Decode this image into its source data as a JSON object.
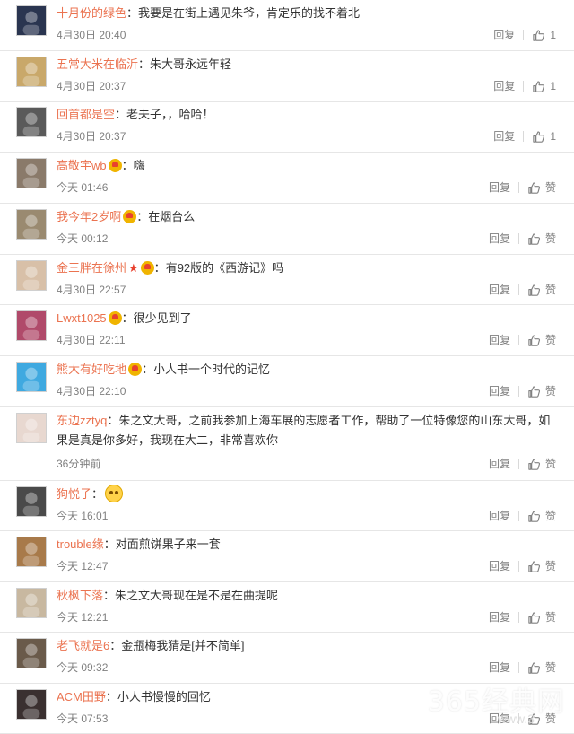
{
  "comments": [
    {
      "user": "十月份的绿色",
      "badge": false,
      "star": false,
      "text": "我要是在街上遇见朱爷，肯定乐的找不着北",
      "time": "4月30日 20:40",
      "reply": "回复",
      "like": "1",
      "avatar_color": "#2a3550"
    },
    {
      "user": "五常大米在临沂",
      "badge": false,
      "star": false,
      "text": "朱大哥永远年轻",
      "time": "4月30日 20:37",
      "reply": "回复",
      "like": "1",
      "avatar_color": "#c9a86a"
    },
    {
      "user": "回首都是空",
      "badge": false,
      "star": false,
      "text": "老夫子，，哈哈！",
      "time": "4月30日 20:37",
      "reply": "回复",
      "like": "1",
      "avatar_color": "#5a5a5a"
    },
    {
      "user": "高敬宇wb",
      "badge": true,
      "star": false,
      "text": "嗨",
      "time": "今天 01:46",
      "reply": "回复",
      "like": "赞",
      "avatar_color": "#8a7a6a"
    },
    {
      "user": "我今年2岁啊",
      "badge": true,
      "star": false,
      "text": "在烟台么",
      "time": "今天 00:12",
      "reply": "回复",
      "like": "赞",
      "avatar_color": "#9a8a70"
    },
    {
      "user": "金三胖在徐州",
      "badge": true,
      "star": true,
      "text": "有92版的《西游记》吗",
      "time": "4月30日 22:57",
      "reply": "回复",
      "like": "赞",
      "avatar_color": "#d8c0a8"
    },
    {
      "user": "Lwxt1025",
      "badge": true,
      "star": false,
      "text": "很少见到了",
      "time": "4月30日 22:11",
      "reply": "回复",
      "like": "赞",
      "avatar_color": "#b04a6a"
    },
    {
      "user": "熊大有好吃地",
      "badge": true,
      "star": false,
      "text": "小人书一个时代的记忆",
      "time": "4月30日 22:10",
      "reply": "回复",
      "like": "赞",
      "avatar_color": "#3fa9e0"
    },
    {
      "user": "东边zztyq",
      "badge": false,
      "star": false,
      "text": "朱之文大哥，之前我参加上海车展的志愿者工作，帮助了一位特像您的山东大哥，如果是真是你多好，我现在大二，非常喜欢你",
      "time": "36分钟前",
      "reply": "回复",
      "like": "赞",
      "avatar_color": "#e8d8d0"
    },
    {
      "user": "狗悦子",
      "badge": false,
      "star": false,
      "text": "",
      "emoji": true,
      "time": "今天 16:01",
      "reply": "回复",
      "like": "赞",
      "avatar_color": "#4a4a4a"
    },
    {
      "user": "trouble缘",
      "badge": false,
      "star": false,
      "text": "对面煎饼果子来一套",
      "time": "今天 12:47",
      "reply": "回复",
      "like": "赞",
      "avatar_color": "#a87a4a"
    },
    {
      "user": "秋枫下落",
      "badge": false,
      "star": false,
      "text": "朱之文大哥现在是不是在曲提呢",
      "time": "今天 12:21",
      "reply": "回复",
      "like": "赞",
      "avatar_color": "#c8b8a0"
    },
    {
      "user": "老飞就是6",
      "badge": false,
      "star": false,
      "text": "金瓶梅我猜是[并不简单]",
      "time": "今天 09:32",
      "reply": "回复",
      "like": "赞",
      "avatar_color": "#6a5a4a"
    },
    {
      "user": "ACM田野",
      "badge": false,
      "star": false,
      "text": "小人书慢慢的回忆",
      "time": "今天 07:53",
      "reply": "回复",
      "like": "赞",
      "avatar_color": "#3a3030"
    }
  ],
  "watermark": "365经典网",
  "watermark_sub": "www.3"
}
